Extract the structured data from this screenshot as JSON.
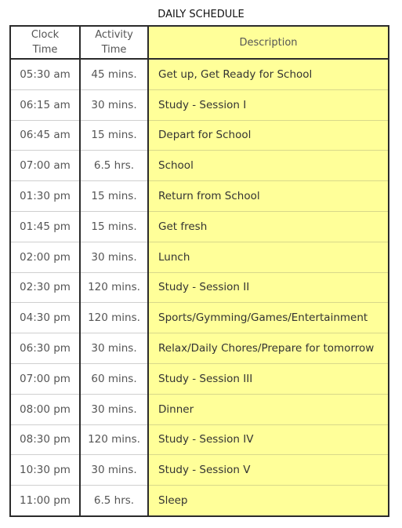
{
  "title": "DAILY SCHEDULE",
  "colors": {
    "description_bg": "#ffff99",
    "border": "#2b2b2b"
  },
  "headers": {
    "clock": "Clock\nTime",
    "clock_l1": "Clock",
    "clock_l2": "Time",
    "activity_l1": "Activity",
    "activity_l2": "Time",
    "description": "Description"
  },
  "rows": [
    {
      "clock": "05:30 am",
      "activity": "45 mins.",
      "description": "Get up, Get Ready for School"
    },
    {
      "clock": "06:15 am",
      "activity": "30 mins.",
      "description": "Study - Session I"
    },
    {
      "clock": "06:45 am",
      "activity": "15 mins.",
      "description": "Depart for School"
    },
    {
      "clock": "07:00 am",
      "activity": "6.5 hrs.",
      "description": "School"
    },
    {
      "clock": "01:30 pm",
      "activity": "15 mins.",
      "description": "Return from School"
    },
    {
      "clock": "01:45 pm",
      "activity": "15 mins.",
      "description": "Get fresh"
    },
    {
      "clock": "02:00 pm",
      "activity": "30 mins.",
      "description": "Lunch"
    },
    {
      "clock": "02:30 pm",
      "activity": "120 mins.",
      "description": "Study - Session II"
    },
    {
      "clock": "04:30 pm",
      "activity": "120 mins.",
      "description": "Sports/Gymming/Games/Entertainment"
    },
    {
      "clock": "06:30 pm",
      "activity": "30 mins.",
      "description": "Relax/Daily Chores/Prepare for tomorrow"
    },
    {
      "clock": "07:00 pm",
      "activity": "60 mins.",
      "description": "Study - Session III"
    },
    {
      "clock": "08:00 pm",
      "activity": "30 mins.",
      "description": "Dinner"
    },
    {
      "clock": "08:30 pm",
      "activity": "120 mins.",
      "description": "Study - Session IV"
    },
    {
      "clock": "10:30 pm",
      "activity": "30 mins.",
      "description": "Study - Session V"
    },
    {
      "clock": "11:00 pm",
      "activity": "6.5 hrs.",
      "description": "Sleep"
    }
  ]
}
